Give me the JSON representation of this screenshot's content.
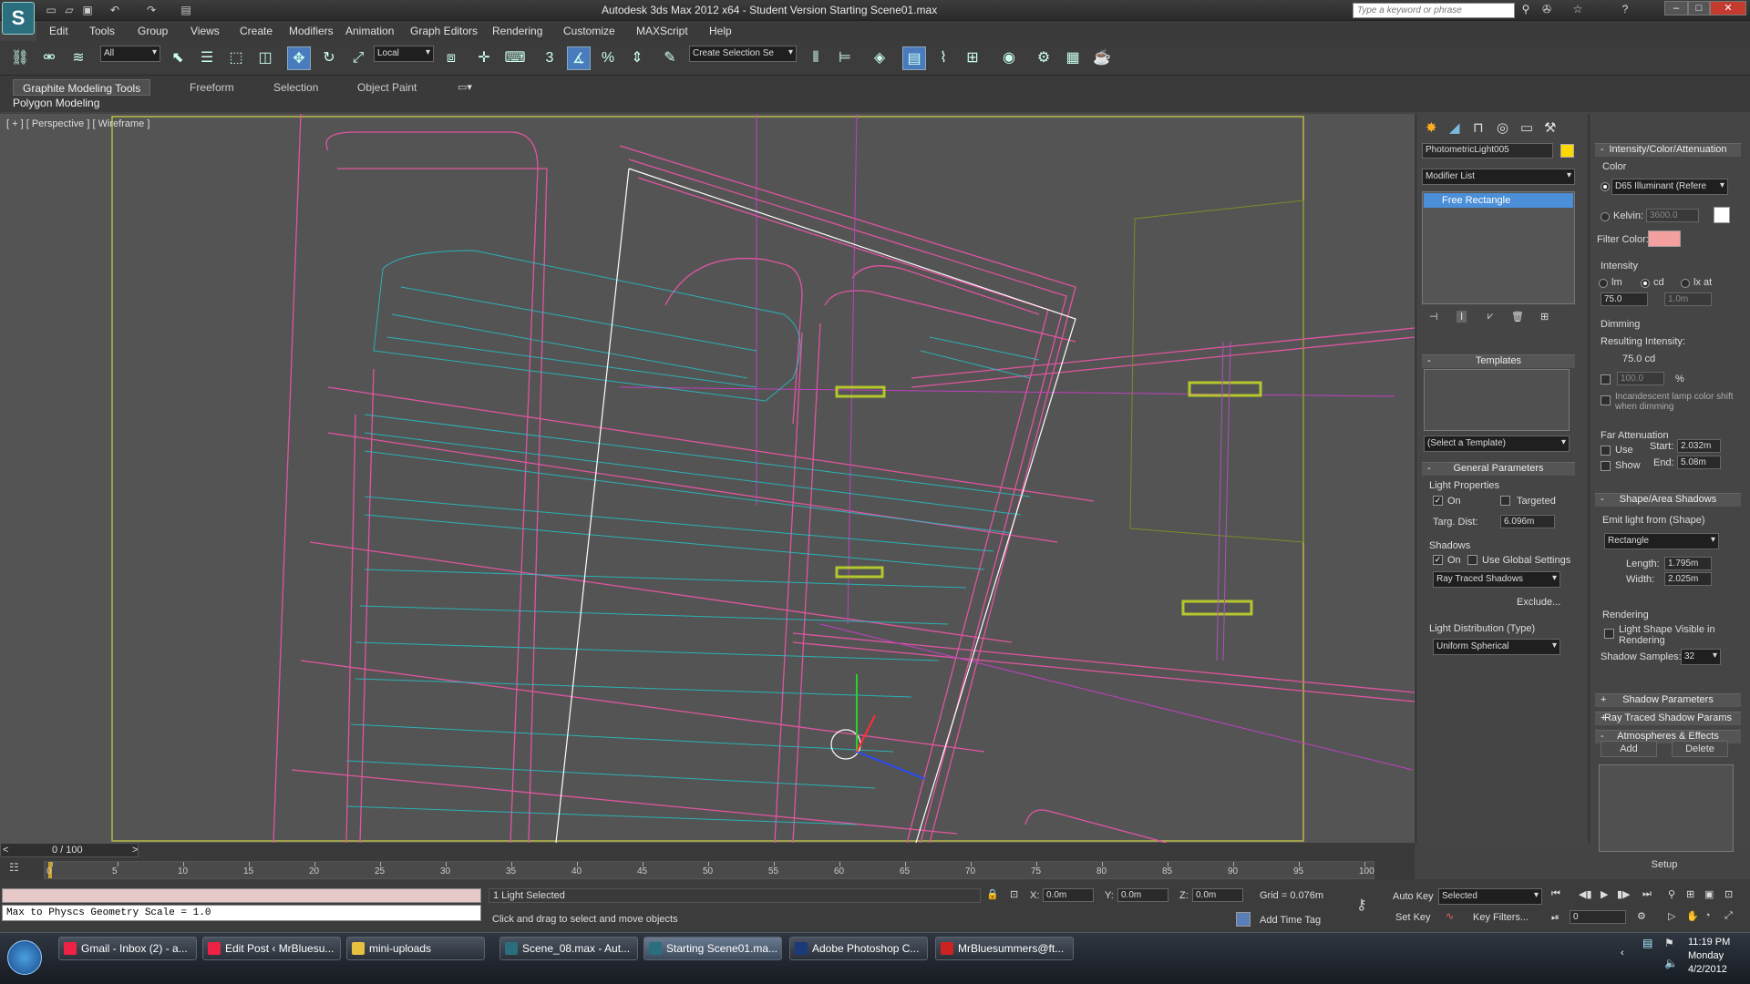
{
  "app": {
    "logo": "S",
    "title": "Autodesk 3ds Max  2012 x64  -  Student Version    Starting Scene01.max",
    "search_placeholder": "Type a keyword or phrase"
  },
  "menu": [
    "Edit",
    "Tools",
    "Group",
    "Views",
    "Create",
    "Modifiers",
    "Animation",
    "Graph Editors",
    "Rendering",
    "Customize",
    "MAXScript",
    "Help"
  ],
  "toolbar": {
    "selection_filter": "All",
    "ref_coord": "Local",
    "named_selection": "Create Selection Se",
    "snap_label": "3"
  },
  "ribbon": {
    "tabs": [
      "Graphite Modeling Tools",
      "Freeform",
      "Selection",
      "Object Paint"
    ],
    "panel": "Polygon Modeling"
  },
  "viewport": {
    "label": "[ + ] [ Perspective ] [ Wireframe ]"
  },
  "command_panel": {
    "object_name": "PhotometricLight005",
    "modifier_list": "Modifier List",
    "stack_item": "Free Rectangle",
    "templates": {
      "title": "Templates",
      "select": "(Select a Template)"
    },
    "general": {
      "title": "General Parameters",
      "light_props": "Light Properties",
      "on": "On",
      "targeted": "Targeted",
      "targ_dist_label": "Targ. Dist:",
      "targ_dist": "6.096m",
      "shadows": "Shadows",
      "shadows_on": "On",
      "use_global": "Use Global Settings",
      "shadow_type": "Ray Traced Shadows",
      "exclude": "Exclude...",
      "dist_label": "Light Distribution (Type)",
      "dist": "Uniform Spherical"
    },
    "intensity": {
      "title": "Intensity/Color/Attenuation",
      "color": "Color",
      "preset": "D65 Illuminant (Refere",
      "kelvin_label": "Kelvin:",
      "kelvin": "3600.0",
      "filter_color": "Filter Color:",
      "intensity_label": "Intensity",
      "lm": "lm",
      "cd": "cd",
      "lx": "lx at",
      "value": "75.0",
      "dist": "1.0m",
      "dimming": "Dimming",
      "resulting": "Resulting Intensity:",
      "resulting_value": "75.0 cd",
      "percent": "100.0",
      "pct_sign": "%",
      "incandescent": "Incandescent lamp color shift when dimming",
      "far_atten": "Far Attenuation",
      "use": "Use",
      "show": "Show",
      "start_label": "Start:",
      "start": "2.032m",
      "end_label": "End:",
      "end": "5.08m"
    },
    "shape": {
      "title": "Shape/Area Shadows",
      "emit": "Emit light from (Shape)",
      "shape": "Rectangle",
      "length_label": "Length:",
      "length": "1.795m",
      "width_label": "Width:",
      "width": "2.025m",
      "rendering": "Rendering",
      "visible": "Light Shape Visible in Rendering",
      "samples_label": "Shadow Samples:",
      "samples": "32"
    },
    "rollouts_collapsed": [
      "Shadow Parameters",
      "Ray Traced Shadow Params"
    ],
    "atmos": {
      "title": "Atmospheres & Effects",
      "add": "Add",
      "delete": "Delete",
      "setup": "Setup"
    }
  },
  "trackbar": {
    "frame": "0 / 100",
    "ticks": [
      "0",
      "5",
      "10",
      "15",
      "20",
      "25",
      "30",
      "35",
      "40",
      "45",
      "50",
      "55",
      "60",
      "65",
      "70",
      "75",
      "80",
      "85",
      "90",
      "95",
      "100"
    ]
  },
  "status": {
    "script_output": "Max to Physcs Geometry Scale = 1.0",
    "selected": "1 Light Selected",
    "prompt": "Click and drag to select and move objects",
    "x_label": "X:",
    "x": "0.0m",
    "y_label": "Y:",
    "y": "0.0m",
    "z_label": "Z:",
    "z": "0.0m",
    "grid": "Grid = 0.076m",
    "add_time_tag": "Add Time Tag",
    "auto_key": "Auto Key",
    "set_key": "Set Key",
    "key_mode": "Selected",
    "key_filters": "Key Filters...",
    "frame": "0"
  },
  "taskbar": {
    "items": [
      "Gmail - Inbox (2) - a...",
      "Edit Post ‹ MrBluesu...",
      "mini-uploads",
      "Scene_08.max - Aut...",
      "Starting Scene01.ma...",
      "Adobe Photoshop C...",
      "MrBluesummers@ft..."
    ],
    "time": "11:19 PM",
    "day": "Monday",
    "date": "4/2/2012"
  }
}
